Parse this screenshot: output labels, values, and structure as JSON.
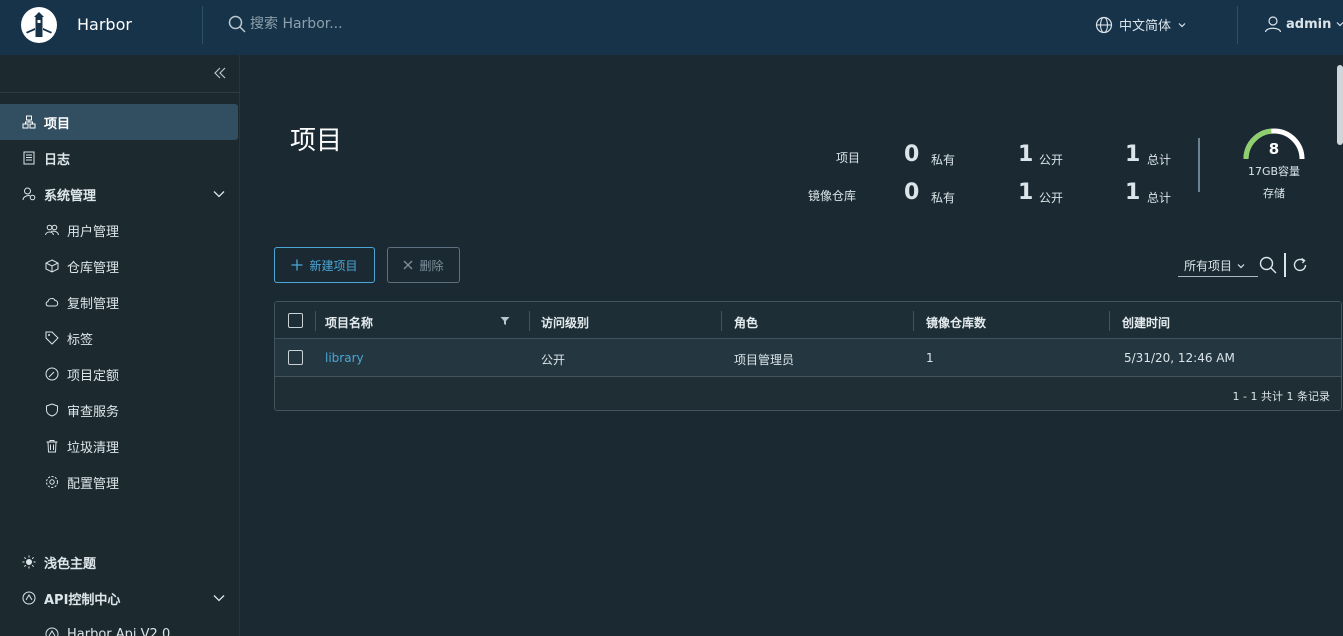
{
  "header": {
    "brand": "Harbor",
    "search_placeholder": "搜索 Harbor...",
    "language": "中文简体",
    "user": "admin"
  },
  "sidebar": {
    "items": [
      {
        "label": "项目",
        "icon": "projects-icon"
      },
      {
        "label": "日志",
        "icon": "logs-icon"
      },
      {
        "label": "系统管理",
        "icon": "admin-icon"
      },
      {
        "label": "用户管理",
        "icon": "users-icon"
      },
      {
        "label": "仓库管理",
        "icon": "registry-icon"
      },
      {
        "label": "复制管理",
        "icon": "cloud-icon"
      },
      {
        "label": "标签",
        "icon": "tag-icon"
      },
      {
        "label": "项目定额",
        "icon": "dashboard-icon"
      },
      {
        "label": "审查服务",
        "icon": "shield-icon"
      },
      {
        "label": "垃圾清理",
        "icon": "trash-icon"
      },
      {
        "label": "配置管理",
        "icon": "gear-icon"
      }
    ],
    "theme": "浅色主题",
    "api_center": "API控制中心",
    "api_v2": "Harbor Api V2.0"
  },
  "main": {
    "title": "项目",
    "stats": {
      "projects_label": "项目",
      "repos_label": "镜像仓库",
      "private_label": "私有",
      "public_label": "公开",
      "total_label": "总计",
      "projects_private": "0",
      "projects_public": "1",
      "projects_total": "1",
      "repos_private": "0",
      "repos_public": "1",
      "repos_total": "1"
    },
    "storage": {
      "value": "8",
      "capacity": "17GB容量",
      "label": "存储",
      "fraction": 0.47
    },
    "buttons": {
      "new_project": "新建项目",
      "delete": "删除"
    },
    "filter": "所有项目",
    "table": {
      "columns": [
        "项目名称",
        "访问级别",
        "角色",
        "镜像仓库数",
        "创建时间"
      ],
      "rows": [
        {
          "name": "library",
          "access": "公开",
          "role": "项目管理员",
          "repos": "1",
          "created": "5/31/20, 12:46 AM"
        }
      ],
      "footer": "1 - 1 共计 1 条记录"
    }
  },
  "colors": {
    "header_bg": "#17334a",
    "body_bg": "#1b2a32",
    "accent": "#4ba6d6",
    "gauge": "#8fcf6e"
  }
}
